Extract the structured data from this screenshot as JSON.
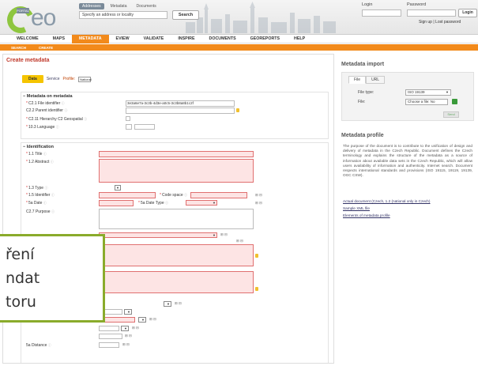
{
  "header": {
    "logo_badge": "PORTAL",
    "logo_text": "eo",
    "search_tabs": [
      "Addresses",
      "Metadata",
      "Documents"
    ],
    "search_placeholder": "Specify an address or locality",
    "search_button": "Search",
    "login_label": "Login",
    "password_label": "Password",
    "login_button": "Login",
    "login_links": "Sign up | Lost password"
  },
  "nav": {
    "items": [
      "WELCOME",
      "MAPS",
      "METADATA",
      "EVIEW",
      "VALIDATE",
      "INSPIRE",
      "DOCUMENTS",
      "GEOREPORTS",
      "HELP"
    ],
    "active": "METADATA",
    "sub_items": [
      "SEARCH",
      "CREATE"
    ]
  },
  "main": {
    "title": "Create metadata",
    "type_data": "Data",
    "type_service": "Service",
    "profile_label": "Profile:",
    "profile_value": "National",
    "sections": {
      "metadata": {
        "title": "Metadata on metadata",
        "fields": [
          {
            "label": "C2.1 File identifier",
            "value": "3e3a6e7a-3c3b-4d3e-a0c5-3c3b8a8b1c2f"
          },
          {
            "label": "C2.2 Parent identifier",
            "value": ""
          },
          {
            "label": "C2.11 Hierarchy C2 Geospatial",
            "value": ""
          },
          {
            "label": "10.3 Language",
            "value": ""
          }
        ]
      },
      "identification": {
        "title": "Identification",
        "fields": [
          "1.1 Title",
          "1.2 Abstract",
          "1.3 Type",
          "1.5 Identifier",
          "5a Date",
          "C2.7 Purpose",
          "5a Distance"
        ],
        "code_space_label": "Code space",
        "date_type_label": "5a Date Type"
      }
    }
  },
  "side": {
    "import_title": "Metadata import",
    "import_tabs": [
      "File",
      "URL"
    ],
    "file_type_label": "File type:",
    "file_type_value": "ISO 19139",
    "file_label": "File:",
    "file_value": "Choose a file: No",
    "send_label": "Send",
    "profile_title": "Metadata profile",
    "profile_text": "The purpose of the document is to contribute to the unification of design and delivery of metadata in the Czech Republic. Document defines the Czech terminology and explains the structure of the metadata as a source of information about available data sets in the Czech Republic, which will allow users availability of information and authenticity. Internet search. Document respects international standards and provisions (ISO 19115, 19119, 19139, OGC CSW).",
    "profile_links": [
      "Actual document (Czech, 1.2 (national only in Czech)",
      "Sample XML file",
      "Elements of metadata profile"
    ]
  },
  "overlay": {
    "lines": [
      "ření",
      "ndat",
      "toru"
    ]
  },
  "colors": {
    "accent": "#f28a1b",
    "logo_green": "#8ec63f",
    "error_fill": "#fde4e4",
    "data_button": "#f5c400",
    "callout_border": "#8aab2b"
  }
}
